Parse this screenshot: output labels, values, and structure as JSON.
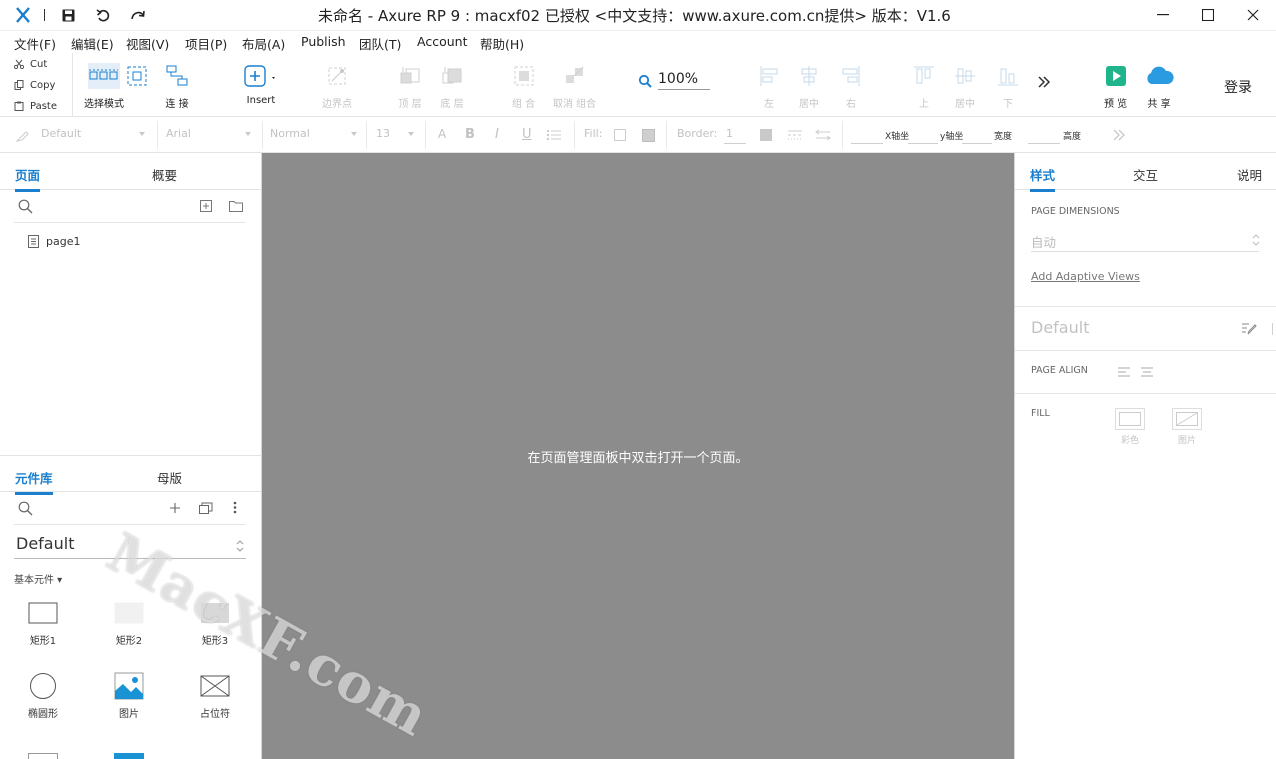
{
  "titlebar": {
    "title": "未命名 - Axure RP 9 : macxf02 已授权     <中文支持：www.axure.com.cn提供> 版本：V1.6",
    "accent": "#1a7fcf"
  },
  "menu": [
    "文件(F)",
    "编辑(E)",
    "视图(V)",
    "项目(P)",
    "布局(A)",
    "Publish",
    "团队(T)",
    "Account",
    "帮助(H)"
  ],
  "toolbar": {
    "clipboard": [
      "Cut",
      "Copy",
      "Paste"
    ],
    "select_mode": "选择模式",
    "connect": "连 接",
    "insert": "Insert",
    "edit_points": "边界点",
    "to_front": "顶 层",
    "to_back": "底 层",
    "group": "组 合",
    "ungroup": "取消 组合",
    "zoom": "100%",
    "align_left": "左",
    "align_center": "居中",
    "align_right": "右",
    "align_top": "上",
    "align_middle": "居中",
    "align_bottom": "下",
    "preview": "预 览",
    "share": "共 享",
    "login": "登录"
  },
  "format": {
    "style": "Default",
    "font": "Arial",
    "weight": "Normal",
    "size": "13",
    "fill_label": "Fill:",
    "border_label": "Border:",
    "border_value": "1",
    "x_label": "X轴坐",
    "y_label": "y轴坐",
    "w_label": "宽度",
    "h_label": "高度"
  },
  "left": {
    "tabs": [
      "页面",
      "概要"
    ],
    "page": "page1",
    "lib_tabs": [
      "元件库",
      "母版"
    ],
    "library": "Default",
    "category": "基本元件 ▾",
    "widgets": [
      "矩形1",
      "矩形2",
      "矩形3",
      "椭圆形",
      "图片",
      "占位符"
    ]
  },
  "canvas": {
    "message": "在页面管理面板中双击打开一个页面。"
  },
  "right": {
    "tabs": [
      "样式",
      "交互",
      "说明"
    ],
    "dims_label": "PAGE DIMENSIONS",
    "dims_value": "自动",
    "adaptive_link": "Add Adaptive Views",
    "style_name": "Default",
    "align_label": "PAGE ALIGN",
    "fill_label": "FILL",
    "fill_color": "彩色",
    "fill_image": "图片"
  },
  "watermark": "MacXF.com"
}
